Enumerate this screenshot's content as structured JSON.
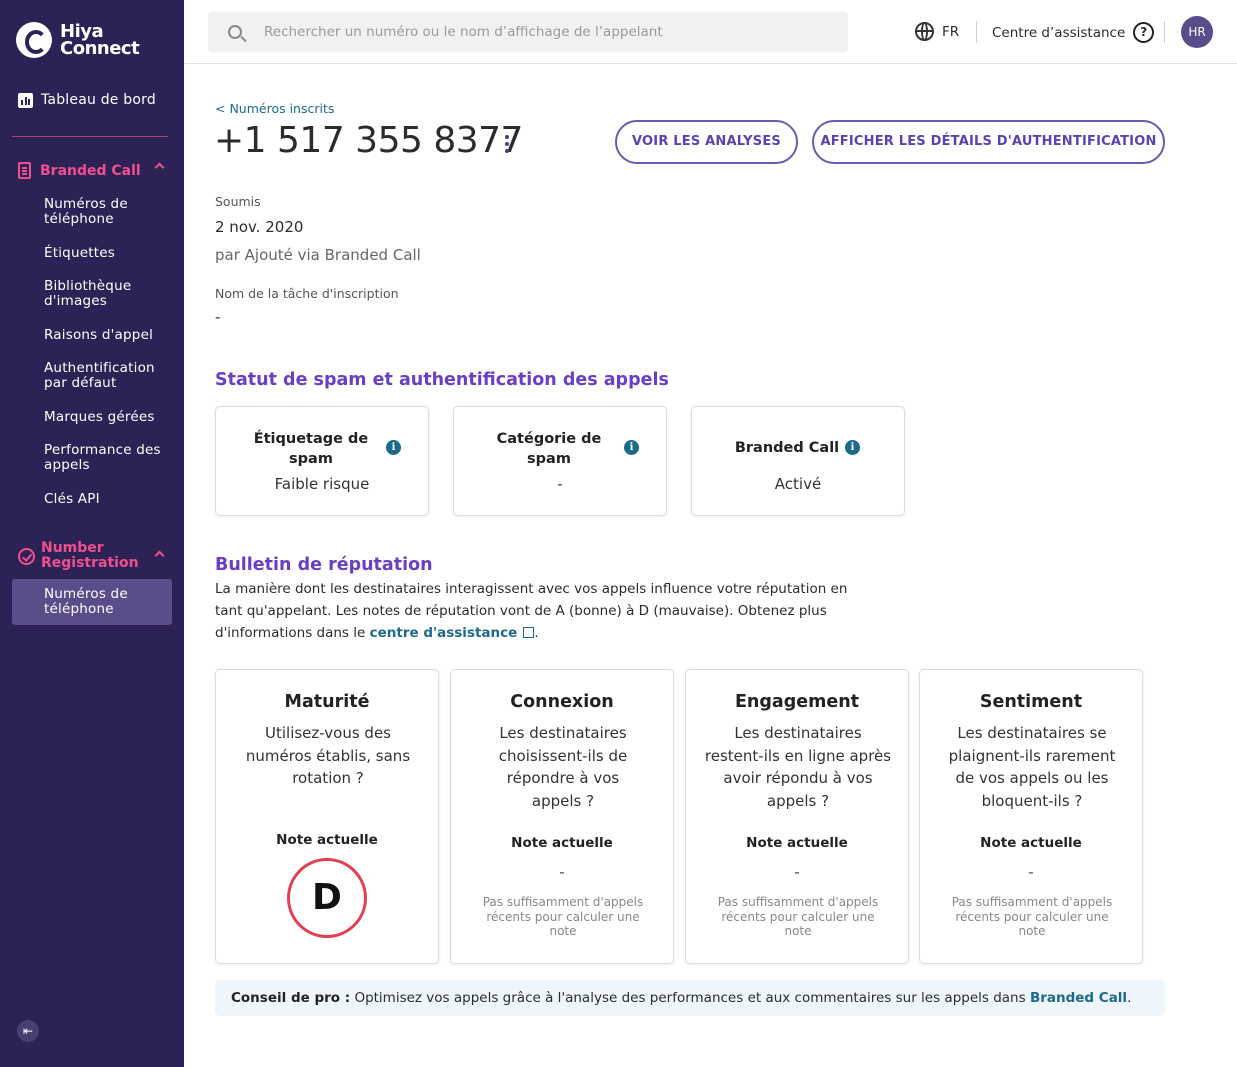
{
  "sidebar": {
    "logo_line1": "Hiya",
    "logo_line2": "Connect",
    "dashboard": "Tableau de bord",
    "branded_call": {
      "title": "Branded Call",
      "items": [
        {
          "l1": "Numéros de",
          "l2": "téléphone"
        },
        {
          "l1": "Étiquettes",
          "l2": ""
        },
        {
          "l1": "Bibliothèque",
          "l2": "d'images"
        },
        {
          "l1": "Raisons d'appel",
          "l2": ""
        },
        {
          "l1": "Authentification",
          "l2": "par défaut"
        },
        {
          "l1": "Marques gérées",
          "l2": ""
        },
        {
          "l1": "Performance des",
          "l2": "appels"
        },
        {
          "l1": "Clés API",
          "l2": ""
        }
      ]
    },
    "number_registration": {
      "title_l1": "Number",
      "title_l2": "Registration",
      "items": [
        {
          "l1": "Numéros de",
          "l2": "téléphone"
        }
      ]
    }
  },
  "topbar": {
    "search_placeholder": "Rechercher un numéro ou le nom d’affichage de l’appelant",
    "language": "FR",
    "help": "Centre d’assistance",
    "avatar": "HR"
  },
  "header": {
    "back": "< Numéros inscrits",
    "phone": "+1 517 355 8377",
    "btn_analytics": "VOIR LES ANALYSES",
    "btn_auth": "AFFICHER LES DÉTAILS D'AUTHENTIFICATION"
  },
  "details": {
    "submitted_label": "Soumis",
    "submitted_date": "2 nov. 2020",
    "submitted_by": "par Ajouté via Branded Call",
    "task_label": "Nom de la tâche d'inscription",
    "task_value": "-"
  },
  "status": {
    "title": "Statut de spam et authentification des appels",
    "cards": [
      {
        "l1": "Étiquetage de",
        "l2": "spam",
        "value": "Faible risque"
      },
      {
        "l1": "Catégorie de",
        "l2": "spam",
        "value": "-"
      },
      {
        "l1": "Branded Call",
        "l2": "",
        "value": "Activé"
      }
    ]
  },
  "reputation": {
    "title": "Bulletin de réputation",
    "desc_l1": "La manière dont les destinataires interagissent avec vos appels influence votre réputation en",
    "desc_l2": "tant qu'appelant. Les notes de réputation vont de A (bonne) à D (mauvaise). Obtenez plus",
    "desc_l3_pre": "d'informations dans le ",
    "desc_link": "centre d'assistance",
    "desc_l3_post": ".",
    "current_label": "Note actuelle",
    "cards": [
      {
        "title": "Maturité",
        "question": "Utilisez-vous des numéros établis, sans rotation ?",
        "grade": "D",
        "note": ""
      },
      {
        "title": "Connexion",
        "question": "Les destinataires choisissent-ils de répondre à vos appels ?",
        "grade": "-",
        "note": "Pas suffisamment d'appels récents pour calculer une note"
      },
      {
        "title": "Engagement",
        "question": "Les destinataires restent-ils en ligne après avoir répondu à vos appels ?",
        "grade": "-",
        "note": "Pas suffisamment d'appels récents pour calculer une note"
      },
      {
        "title": "Sentiment",
        "question": "Les destinataires se plaignent-ils rarement de vos appels ou les bloquent-ils ?",
        "grade": "-",
        "note": "Pas suffisamment d'appels récents pour calculer une note"
      }
    ]
  },
  "tip": {
    "label": "Conseil de pro :",
    "text": " Optimisez vos appels grâce à l'analyse des performances et aux commentaires sur les appels dans ",
    "link": "Branded Call",
    "end": "."
  },
  "colors": {
    "sidebar_bg": "#2c2255",
    "accent_pink": "#f0508f",
    "accent_purple": "#6b3fc2",
    "link_teal": "#1b6a8c",
    "grade_red": "#e0404f"
  },
  "icons": [
    "logo-icon",
    "dashboard-icon",
    "phone-icon",
    "chevron-up-icon",
    "badge-check-icon",
    "collapse-icon",
    "search-icon",
    "globe-icon",
    "help-icon",
    "kebab-icon",
    "info-icon",
    "external-link-icon"
  ]
}
